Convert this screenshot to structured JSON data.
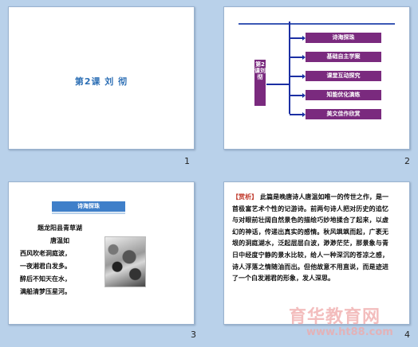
{
  "slides": [
    {
      "number": "1",
      "title": "第2课  刘  彻"
    },
    {
      "number": "2",
      "left_label": "第2课刘彻",
      "boxes": [
        "诗海探珠",
        "基础自主学案",
        "课堂互动探究",
        "知能优化演练",
        "美文佳作欣赏"
      ]
    },
    {
      "number": "3",
      "header": "诗海探珠",
      "poem_title": "题龙阳县青草湖",
      "poem_author": "唐温如",
      "poem_lines": [
        "西风吹老洞庭波，",
        "一夜湘君白发多。",
        "醉后不知天在水，",
        "满船清梦压星河。"
      ],
      "image_icon": "ink-landscape-image"
    },
    {
      "number": "4",
      "analysis_tag": "【赏析】",
      "analysis_text": "此篇是晚唐诗人唐温如唯一的传世之作，是一首极富艺术个性的记游诗。前两句诗人把对历史的追忆与对眼前壮阔自然景色的描绘巧妙地揉合了起来，以虚幻的神话，传递出真实的感情。秋风飒飒而起，广袤无垠的洞庭湖水，泛起层层白波，渺渺茫茫，那景象与青日中经度宁静的景水比较，给人一种深沉的苍凉之感，诗人浮落之情随油而出。但他故意不用直说，而是迹进了一个白发湘君的形象，发人深思。"
    }
  ],
  "watermark": {
    "top": "育华教育网",
    "bottom": "www.ht88.com"
  },
  "colors": {
    "accent": "#7a2a7e",
    "header_blue": "#3f7fc9",
    "title_blue": "#2d6fb5",
    "tag_red": "#c0392b"
  }
}
